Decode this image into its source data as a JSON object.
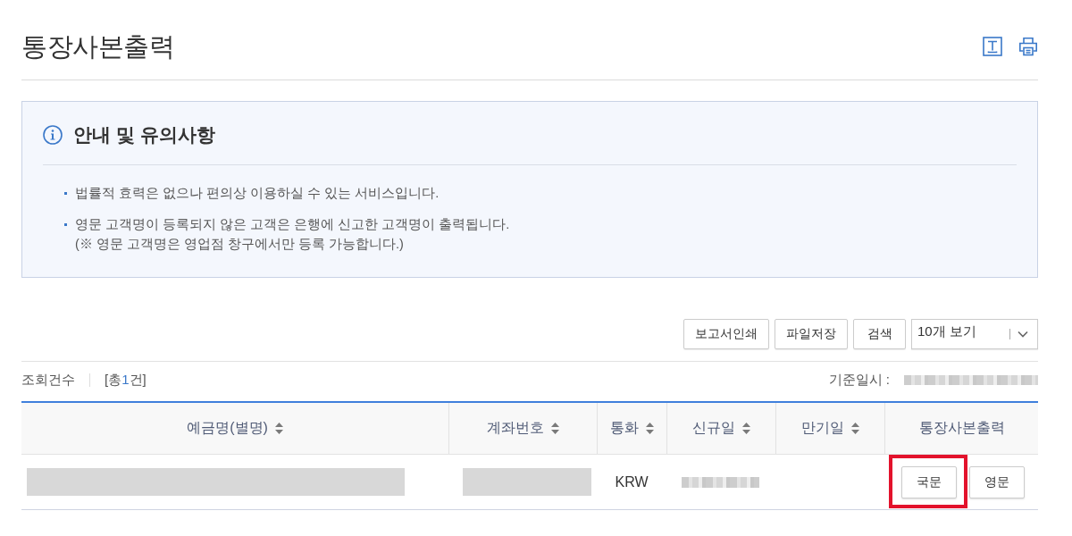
{
  "page": {
    "title": "통장사본출력"
  },
  "notice": {
    "title": "안내 및 유의사항",
    "items": [
      {
        "text": "법률적 효력은 없으나 편의상 이용하실 수 있는 서비스입니다."
      },
      {
        "text": "영문 고객명이 등록되지 않은 고객은 은행에 신고한 고객명이 출력됩니다.",
        "note": "(※ 영문 고객명은 영업점 창구에서만 등록 가능합니다.)"
      }
    ]
  },
  "toolbar": {
    "buttons": [
      "보고서인쇄",
      "파일저장",
      "검색"
    ],
    "page_size": {
      "value": "10개 보기"
    }
  },
  "summary": {
    "label": "조회건수",
    "total_before": "[총",
    "count": "1",
    "total_after": "건]",
    "as_of_label": "기준일시 :"
  },
  "table": {
    "columns": [
      {
        "label": "예금명(별명)",
        "sortable": true
      },
      {
        "label": "계좌번호",
        "sortable": true
      },
      {
        "label": "통화",
        "sortable": true
      },
      {
        "label": "신규일",
        "sortable": true
      },
      {
        "label": "만기일",
        "sortable": true
      },
      {
        "label": "통장사본출력",
        "sortable": false
      }
    ],
    "rows": [
      {
        "cells": [
          {
            "kind": "redacted"
          },
          {
            "kind": "redacted"
          },
          {
            "kind": "text",
            "text": "KRW"
          },
          {
            "kind": "blurred"
          },
          {
            "kind": "empty"
          },
          {
            "kind": "buttons",
            "buttons": [
              {
                "label": "국문",
                "highlighted": true
              },
              {
                "label": "영문",
                "highlighted": false
              }
            ]
          }
        ]
      }
    ]
  }
}
